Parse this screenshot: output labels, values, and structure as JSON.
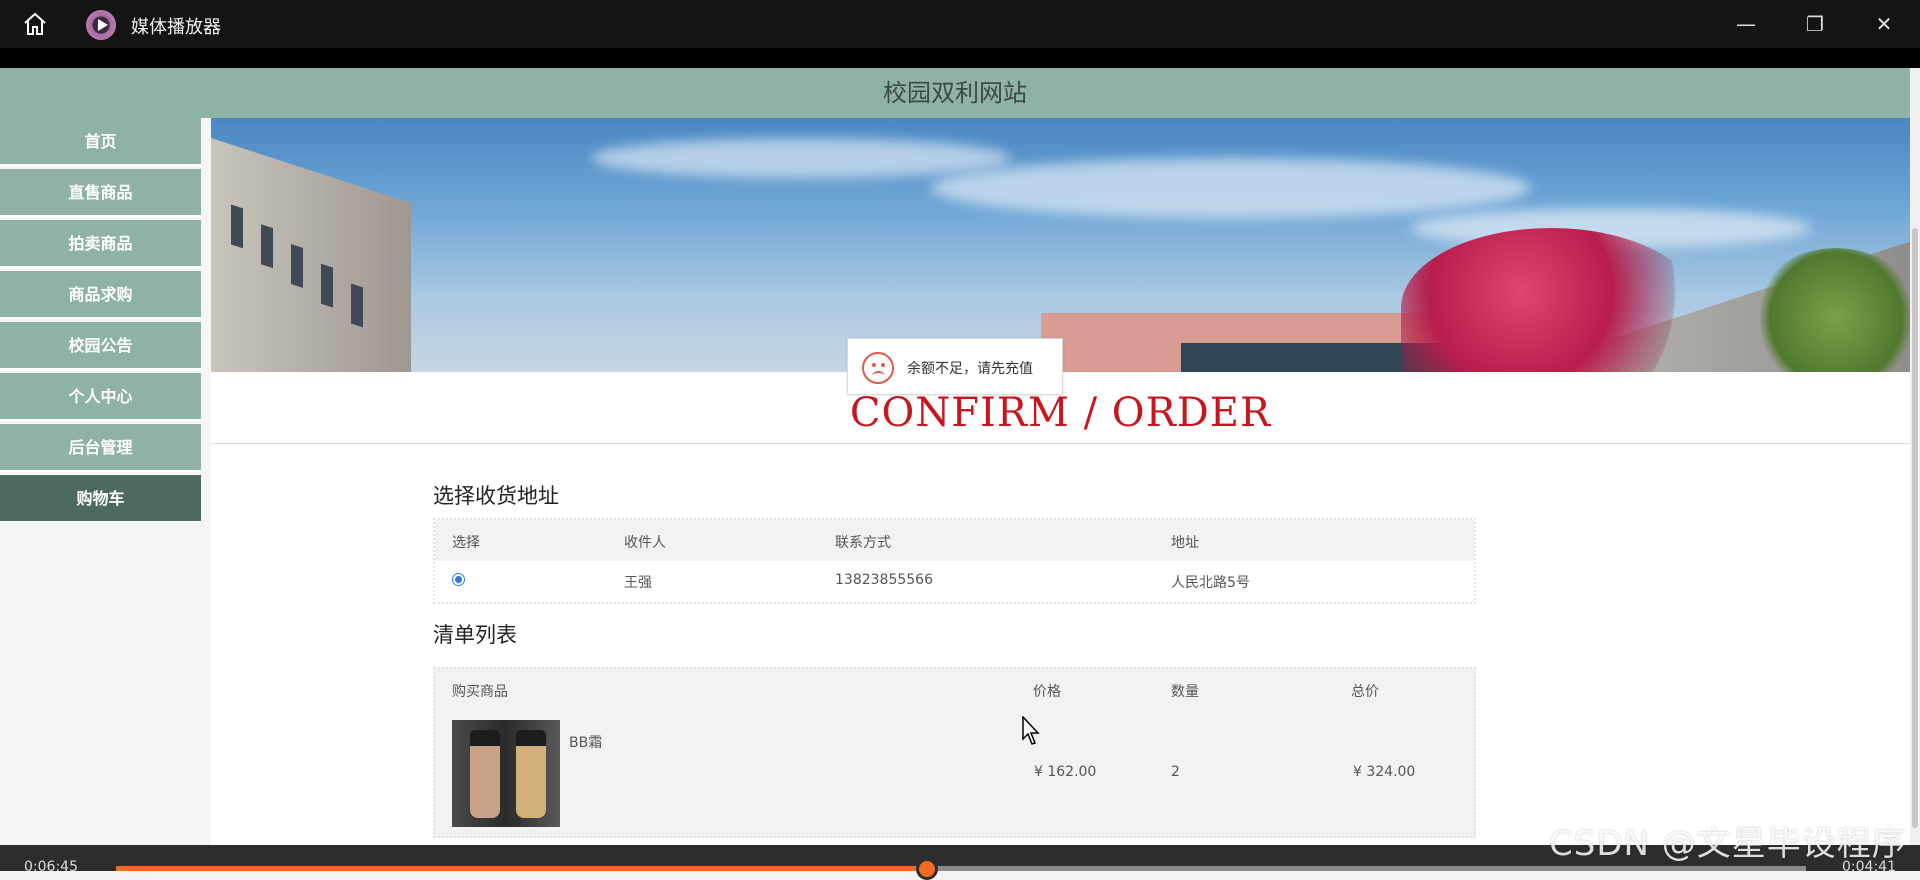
{
  "window": {
    "title": "媒体播放器",
    "minimize": "—",
    "maximize": "❐",
    "close": "✕"
  },
  "site": {
    "title": "校园双利网站"
  },
  "sidebar": {
    "items": [
      {
        "label": "首页"
      },
      {
        "label": "直售商品"
      },
      {
        "label": "拍卖商品"
      },
      {
        "label": "商品求购"
      },
      {
        "label": "校园公告"
      },
      {
        "label": "个人中心"
      },
      {
        "label": "后台管理"
      },
      {
        "label": "购物车",
        "active": true
      }
    ]
  },
  "page": {
    "heading": "CONFIRM / ORDER"
  },
  "toast": {
    "message": "余额不足，请先充值",
    "icon": "sad-face-icon"
  },
  "address": {
    "title": "选择收货地址",
    "columns": [
      "选择",
      "收件人",
      "联系方式",
      "地址"
    ],
    "rows": [
      {
        "selected": true,
        "recipient": "王强",
        "phone": "13823855566",
        "address": "人民北路5号"
      }
    ]
  },
  "order": {
    "title": "清单列表",
    "columns": [
      "购买商品",
      "价格",
      "数量",
      "总价"
    ],
    "items": [
      {
        "name": "BB霜",
        "price": "¥ 162.00",
        "quantity": "2",
        "total": "¥ 324.00"
      }
    ]
  },
  "player": {
    "elapsed": "0:06:45",
    "remaining": "0:04:41",
    "progress": 0.48
  },
  "watermark": "CSDN @文星毕设程序",
  "colors": {
    "accent": "#ef6a24",
    "nav": "#8eb2a4",
    "nav_active": "#4d6a5f",
    "heading_red": "#c8161d"
  }
}
